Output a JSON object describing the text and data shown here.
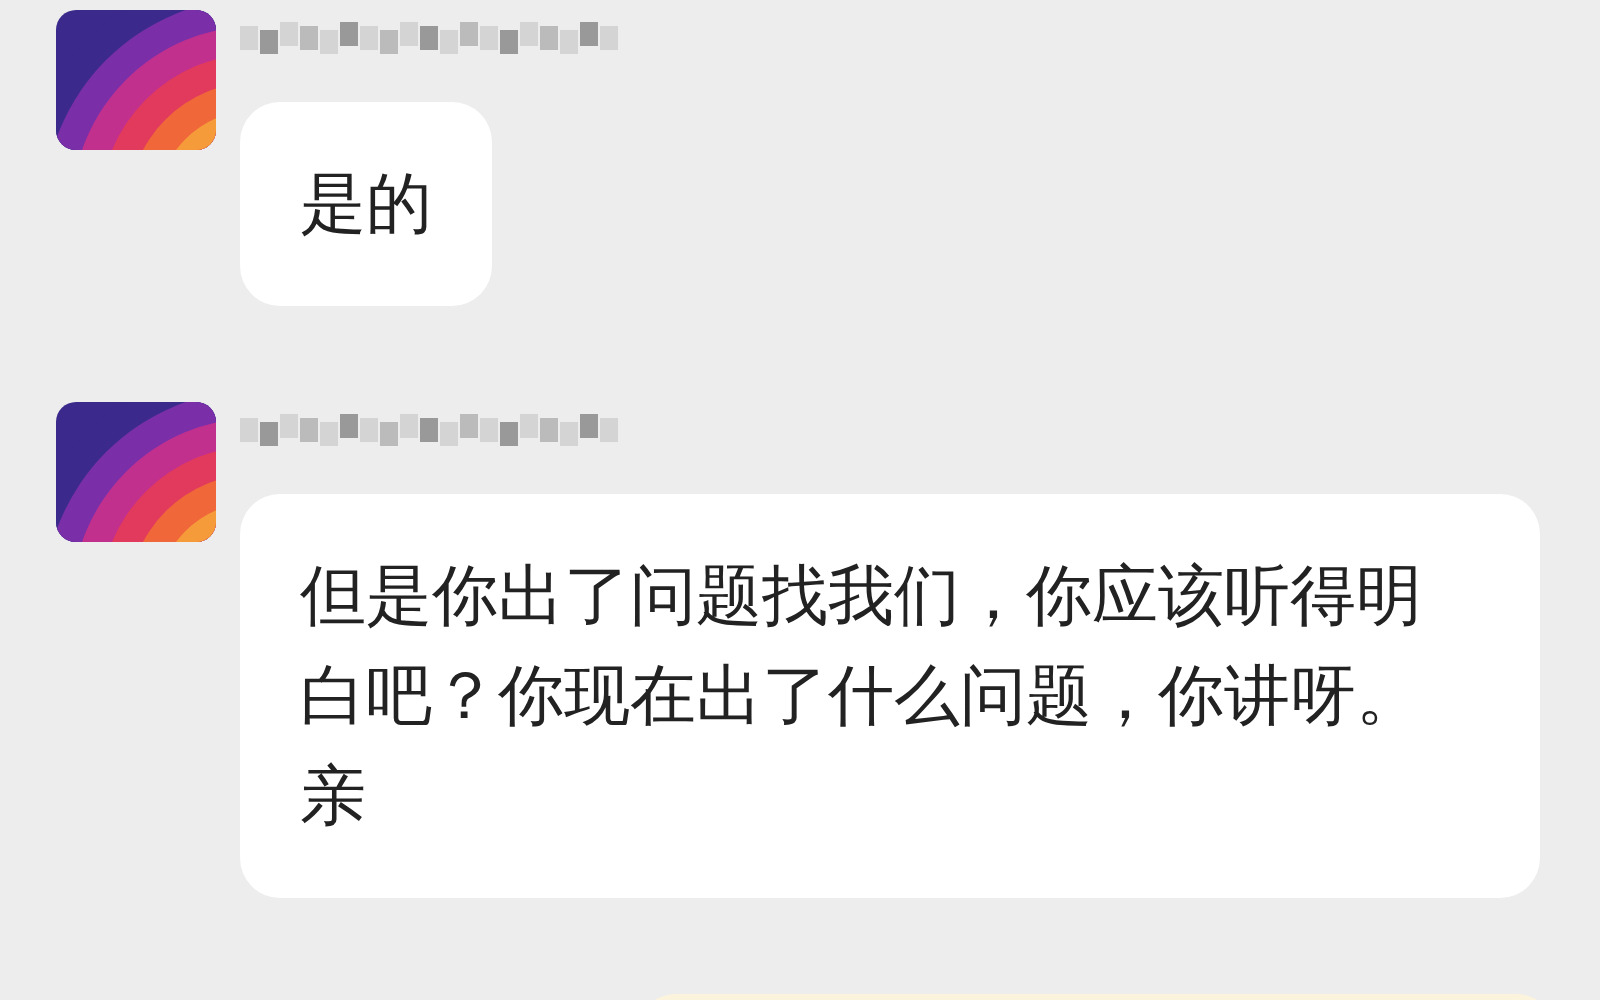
{
  "messages": [
    {
      "kind": "received",
      "text": "是的"
    },
    {
      "kind": "received",
      "text": "但是你出了问题找我们，你应该听得明白吧？你现在出了什么问题，你讲呀。亲"
    },
    {
      "kind": "sent"
    }
  ]
}
